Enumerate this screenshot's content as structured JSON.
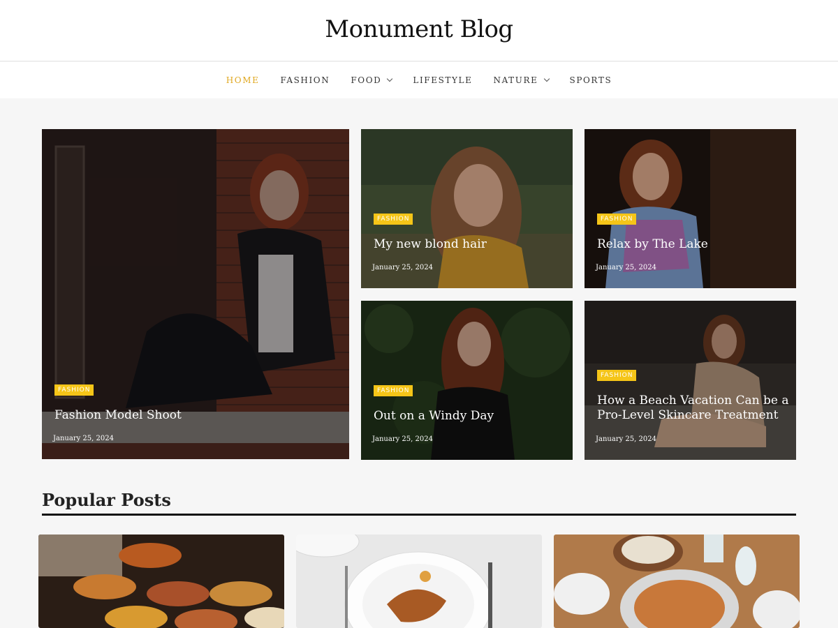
{
  "site": {
    "title": "Monument Blog"
  },
  "nav": {
    "items": [
      {
        "label": "HOME",
        "active": true,
        "dropdown": false
      },
      {
        "label": "FASHION",
        "active": false,
        "dropdown": false
      },
      {
        "label": "FOOD",
        "active": false,
        "dropdown": true
      },
      {
        "label": "LIFESTYLE",
        "active": false,
        "dropdown": false
      },
      {
        "label": "NATURE",
        "active": false,
        "dropdown": true
      },
      {
        "label": "SPORTS",
        "active": false,
        "dropdown": false
      }
    ]
  },
  "featured": [
    {
      "category": "FASHION",
      "title": "Fashion Model Shoot",
      "date": "January 25, 2024"
    },
    {
      "category": "FASHION",
      "title": "My new blond hair",
      "date": "January 25, 2024"
    },
    {
      "category": "FASHION",
      "title": "Relax by The Lake",
      "date": "January 25, 2024"
    },
    {
      "category": "FASHION",
      "title": "Out on a Windy Day",
      "date": "January 25, 2024"
    },
    {
      "category": "FASHION",
      "title_line1": "How a Beach Vacation Can be a",
      "title_line2": "Pro-Level Skincare Treatment",
      "date": "January 25, 2024"
    }
  ],
  "popular": {
    "title": "Popular Posts"
  },
  "colors": {
    "accent": "#f5c518",
    "active_nav": "#e0a820"
  }
}
